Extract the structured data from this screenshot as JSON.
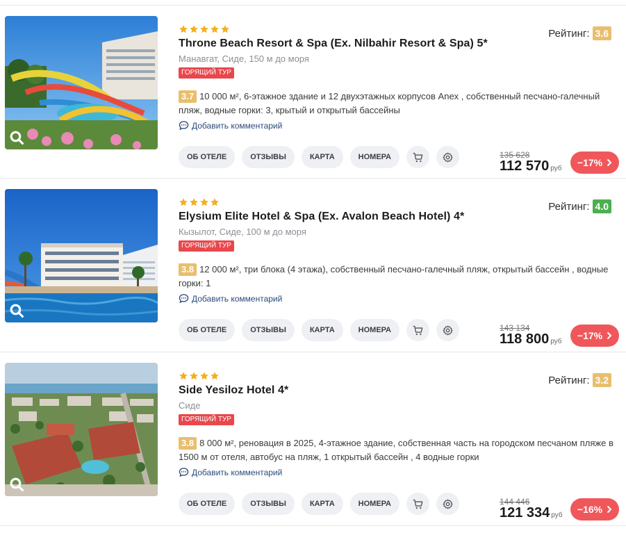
{
  "ui": {
    "rating_label": "Рейтинг:",
    "hot_label": "ГОРЯЩИЙ ТУР",
    "comment_label": "Добавить комментарий",
    "btn_about": "ОБ ОТЕЛЕ",
    "btn_reviews": "ОТЗЫВЫ",
    "btn_map": "КАРТА",
    "btn_rooms": "НОМЕРА",
    "currency": "руб"
  },
  "colors": {
    "star": "#f2b01e",
    "hot": "#e8474c",
    "rating_yellow": "#e9be6c",
    "rating_green": "#4caf50",
    "discount": "#f0575a",
    "link": "#2a4b7c"
  },
  "hotels": [
    {
      "stars": 5,
      "title": "Throne Beach Resort & Spa (Ex. Nilbahir Resort & Spa) 5*",
      "location": "Манавгат, Сиде, 150 м до моря",
      "rating": "3.6",
      "rating_color": "yellow",
      "desc_score": "3.7",
      "description": "10 000 м², 6-этажное здание и 12 двухэтажных корпусов Anex , собственный песчано-галечный пляж, водные горки: 3, крытый и открытый бассейны",
      "old_price": "135 628",
      "price": "112 570",
      "discount": "−17%"
    },
    {
      "stars": 4,
      "title": "Elysium Elite Hotel & Spa (Ex. Avalon Beach Hotel) 4*",
      "location": "Кызылот, Сиде, 100 м до моря",
      "rating": "4.0",
      "rating_color": "green",
      "desc_score": "3.8",
      "description": "12 000 м², три блока (4 этажа), собственный песчано-галечный пляж, открытый бассейн , водные горки: 1",
      "old_price": "143 134",
      "price": "118 800",
      "discount": "−17%"
    },
    {
      "stars": 4,
      "title": "Side Yesiloz Hotel 4*",
      "location": "Сиде",
      "rating": "3.2",
      "rating_color": "yellow",
      "desc_score": "3.8",
      "description": "8 000 м², реновация в 2025, 4-этажное здание, собственная часть на городском песчаном пляже в 1500 м от отеля, автобус на пляж, 1 открытый бассейн , 4 водные горки",
      "old_price": "144 446",
      "price": "121 334",
      "discount": "−16%"
    }
  ]
}
